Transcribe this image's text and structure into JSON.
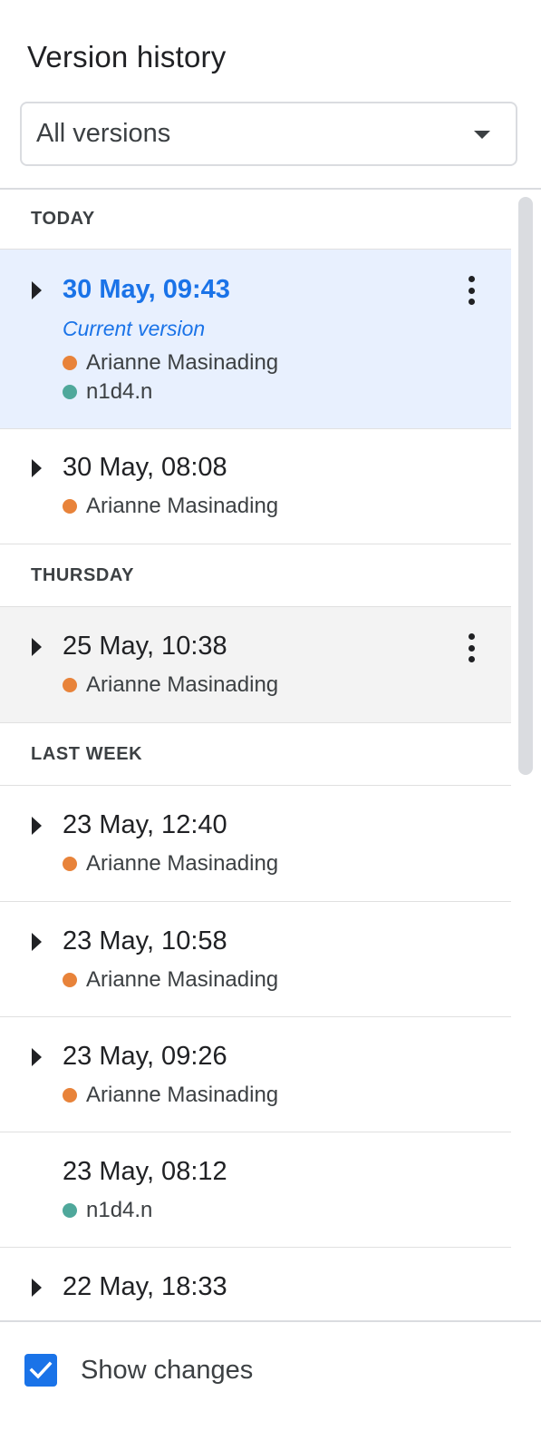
{
  "panel": {
    "title": "Version history"
  },
  "filter": {
    "selected": "All versions"
  },
  "colors": {
    "accent": "#1a73e8",
    "selected_bg": "#e8f0fe",
    "hover_bg": "#f3f3f3",
    "editor_orange": "#e8833a",
    "editor_teal": "#4fa89b"
  },
  "sections": [
    {
      "header": "TODAY",
      "versions": [
        {
          "time": "30 May, 09:43",
          "current_label": "Current version",
          "editors": [
            {
              "name": "Arianne Masinading",
              "color": "#e8833a"
            },
            {
              "name": "n1d4.n",
              "color": "#4fa89b"
            }
          ]
        },
        {
          "time": "30 May, 08:08",
          "editors": [
            {
              "name": "Arianne Masinading",
              "color": "#e8833a"
            }
          ]
        }
      ]
    },
    {
      "header": "THURSDAY",
      "versions": [
        {
          "time": "25 May, 10:38",
          "editors": [
            {
              "name": "Arianne Masinading",
              "color": "#e8833a"
            }
          ]
        }
      ]
    },
    {
      "header": "LAST WEEK",
      "versions": [
        {
          "time": "23 May, 12:40",
          "editors": [
            {
              "name": "Arianne Masinading",
              "color": "#e8833a"
            }
          ]
        },
        {
          "time": "23 May, 10:58",
          "editors": [
            {
              "name": "Arianne Masinading",
              "color": "#e8833a"
            }
          ]
        },
        {
          "time": "23 May, 09:26",
          "editors": [
            {
              "name": "Arianne Masinading",
              "color": "#e8833a"
            }
          ]
        },
        {
          "time": "23 May, 08:12",
          "editors": [
            {
              "name": "n1d4.n",
              "color": "#4fa89b"
            }
          ]
        },
        {
          "time": "22 May, 18:33",
          "editors": []
        }
      ]
    }
  ],
  "footer": {
    "show_changes_label": "Show changes",
    "show_changes_checked": true
  }
}
